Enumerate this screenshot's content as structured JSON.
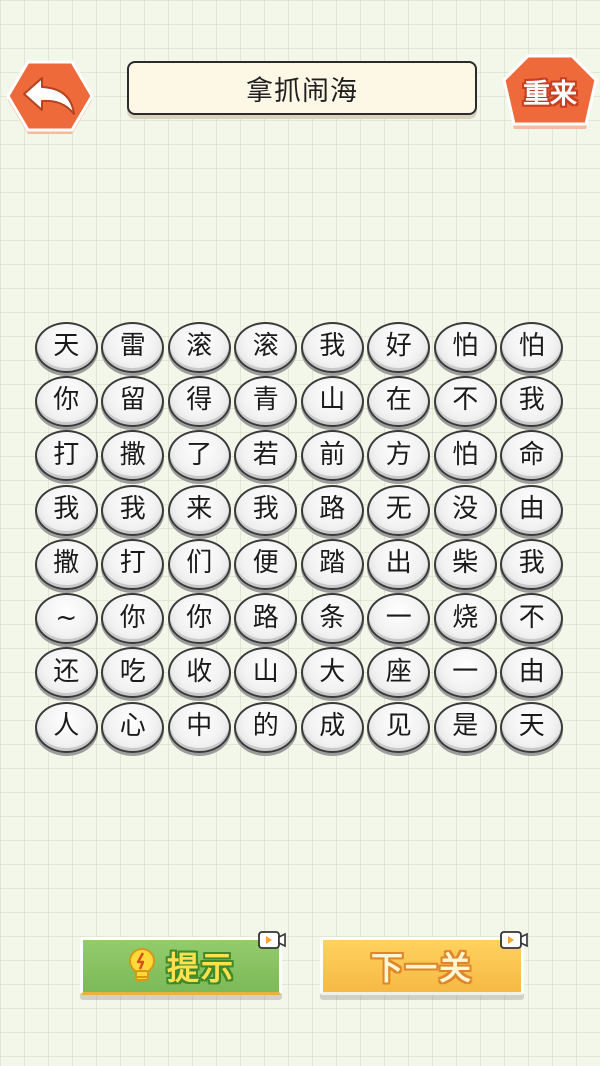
{
  "header": {
    "title": "拿抓闹海",
    "restart_label": "重来",
    "back_icon": "back-arrow-icon"
  },
  "grid": {
    "rows": [
      [
        "天",
        "雷",
        "滚",
        "滚",
        "我",
        "好",
        "怕",
        "怕"
      ],
      [
        "你",
        "留",
        "得",
        "青",
        "山",
        "在",
        "不",
        "我"
      ],
      [
        "打",
        "撒",
        "了",
        "若",
        "前",
        "方",
        "怕",
        "命"
      ],
      [
        "我",
        "我",
        "来",
        "我",
        "路",
        "无",
        "没",
        "由"
      ],
      [
        "撒",
        "打",
        "们",
        "便",
        "踏",
        "出",
        "柴",
        "我"
      ],
      [
        "~",
        "你",
        "你",
        "路",
        "条",
        "一",
        "烧",
        "不"
      ],
      [
        "还",
        "吃",
        "收",
        "山",
        "大",
        "座",
        "一",
        "由"
      ],
      [
        "人",
        "心",
        "中",
        "的",
        "成",
        "见",
        "是",
        "天"
      ]
    ]
  },
  "buttons": {
    "hint_label": "提示",
    "next_label": "下一关",
    "hint_icon": "lightbulb-icon",
    "video_icon": "video-ad-icon"
  },
  "colors": {
    "back_button": "#ef6a3c",
    "restart_button": "#ef6a3c",
    "hint_button": "#86c262",
    "next_button": "#f8c24c",
    "background": "#f3f7ea"
  }
}
